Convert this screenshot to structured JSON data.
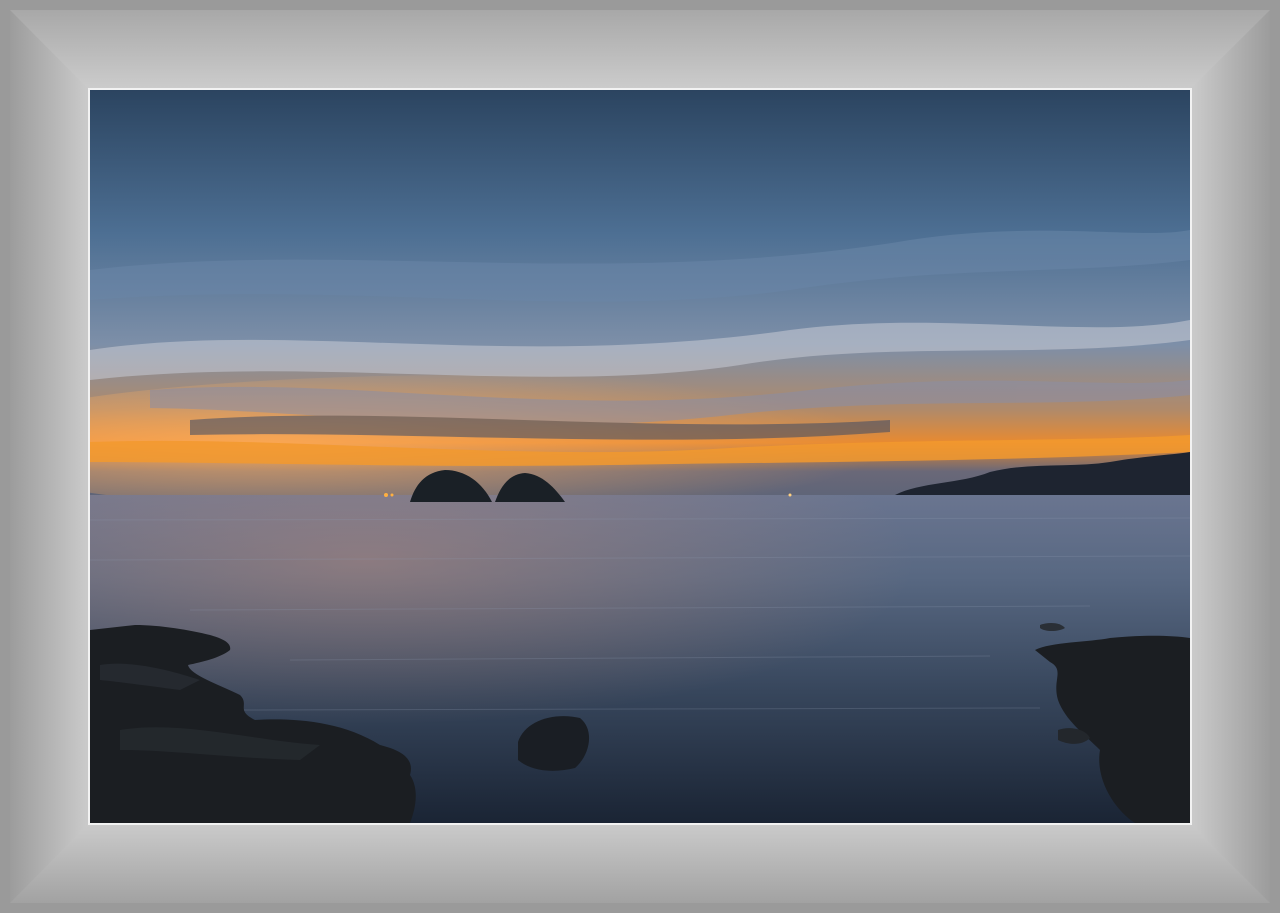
{
  "scene": {
    "subject": "seascape-at-dusk",
    "colors": {
      "sky_top": "#2d4a66",
      "sky_mid": "#5d7fa0",
      "sunset_glow": "#f08a2a",
      "horizon": "#6c6f80",
      "water": "#4a5870",
      "water_dark": "#1e2a3a",
      "rocks": "#15181c",
      "mat": "#cccccc",
      "outer_frame": "#9a9a9a"
    }
  }
}
